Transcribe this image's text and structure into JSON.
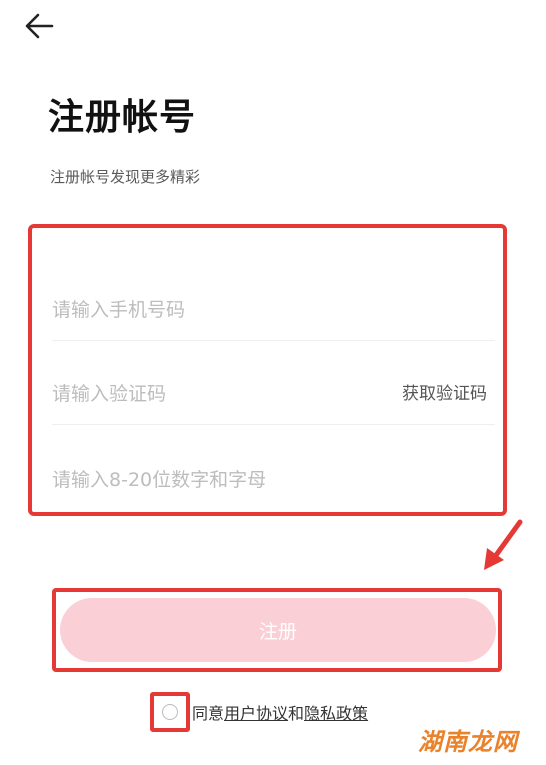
{
  "header": {
    "back_icon": "back-arrow-icon"
  },
  "page": {
    "title": "注册帐号",
    "subtitle": "注册帐号发现更多精彩"
  },
  "form": {
    "phone_placeholder": "请输入手机号码",
    "code_placeholder": "请输入验证码",
    "get_code_label": "获取验证码",
    "password_placeholder": "请输入8-20位数字和字母"
  },
  "actions": {
    "register_label": "注册"
  },
  "agreement": {
    "prefix": "同意",
    "user_agreement": "用户协议",
    "and": "和",
    "privacy_policy": "隐私政策"
  },
  "watermark": "湖南龙网",
  "colors": {
    "highlight": "#e53935",
    "button": "#fbcfd6",
    "watermark": "#e9822a"
  }
}
